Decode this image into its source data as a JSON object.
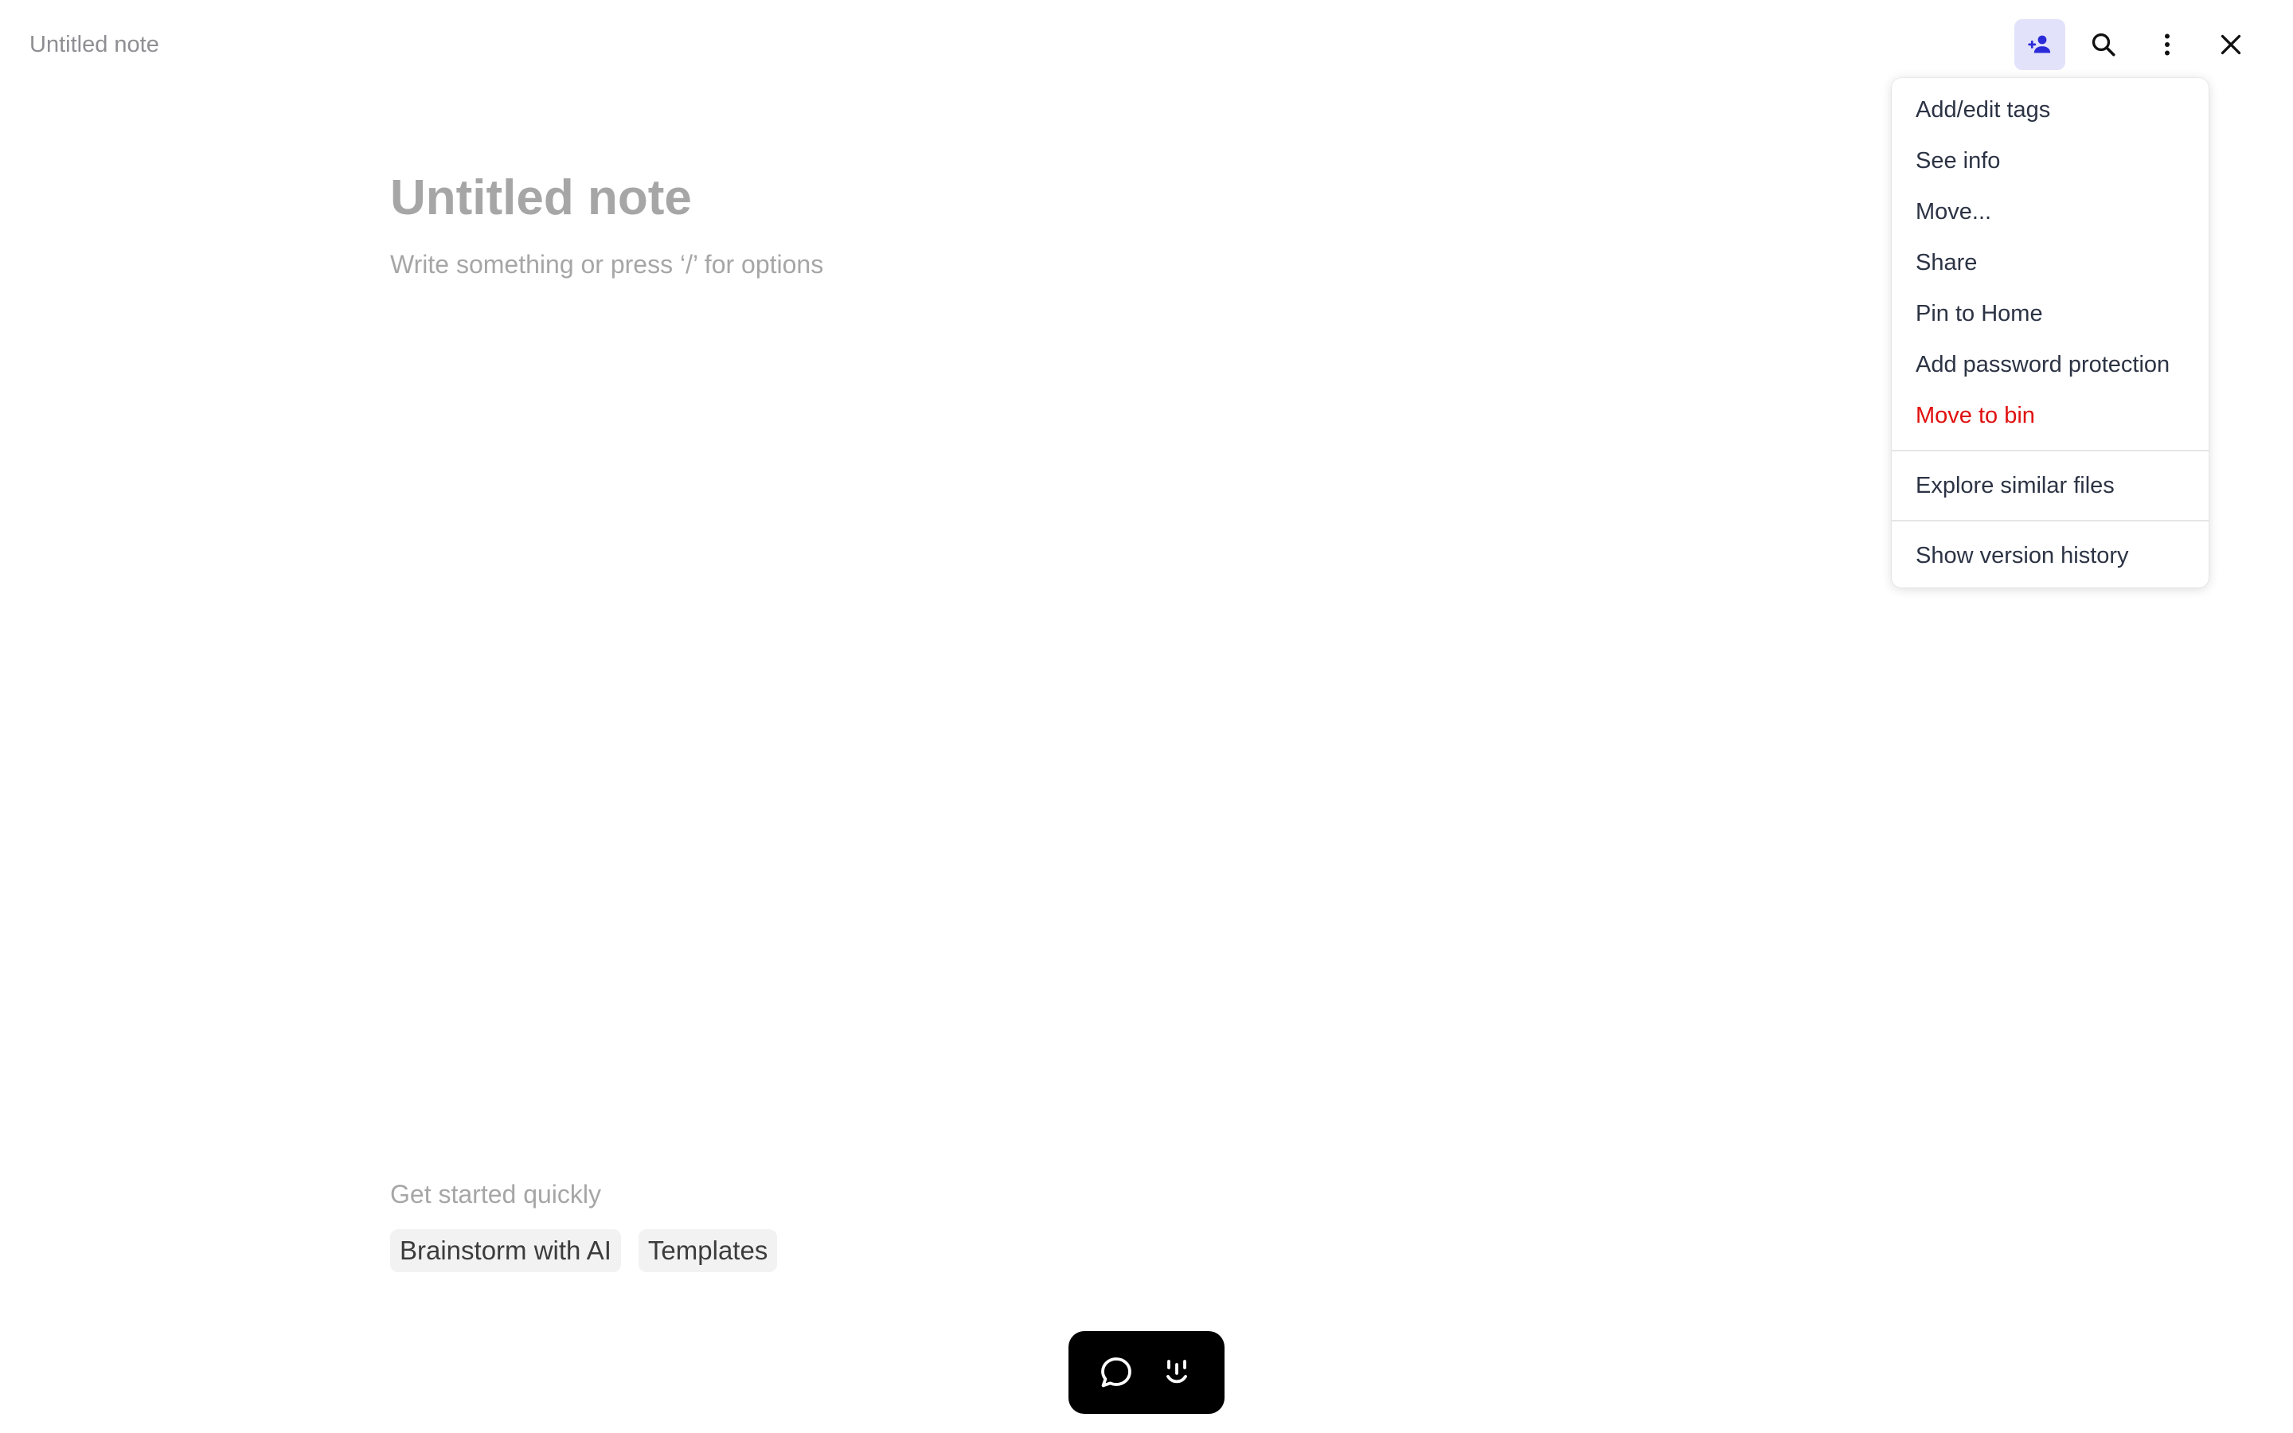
{
  "window": {
    "title": "Untitled note"
  },
  "toolbar": {
    "buttons": [
      {
        "icon": "person-add-icon",
        "active": true,
        "color": "#2b2bd9"
      },
      {
        "icon": "search-icon"
      },
      {
        "icon": "more-vertical-icon"
      },
      {
        "icon": "close-icon"
      }
    ]
  },
  "editor": {
    "title_placeholder": "Untitled note",
    "body_placeholder": "Write something or press ‘/’ for options"
  },
  "quick_start": {
    "label": "Get started quickly",
    "chips": [
      "Brainstorm with AI",
      "Templates"
    ]
  },
  "assist_bar": {
    "buttons": [
      {
        "icon": "chat-bubble-icon"
      },
      {
        "icon": "smiley-face-icon"
      }
    ]
  },
  "menu": {
    "group1": [
      "Add/edit tags",
      "See info",
      "Move...",
      "Share",
      "Pin to Home",
      "Add password protection"
    ],
    "danger_item": "Move to bin",
    "danger_color": "#e0100f",
    "group2": [
      "Explore similar files"
    ],
    "group3": [
      "Show version history"
    ]
  }
}
